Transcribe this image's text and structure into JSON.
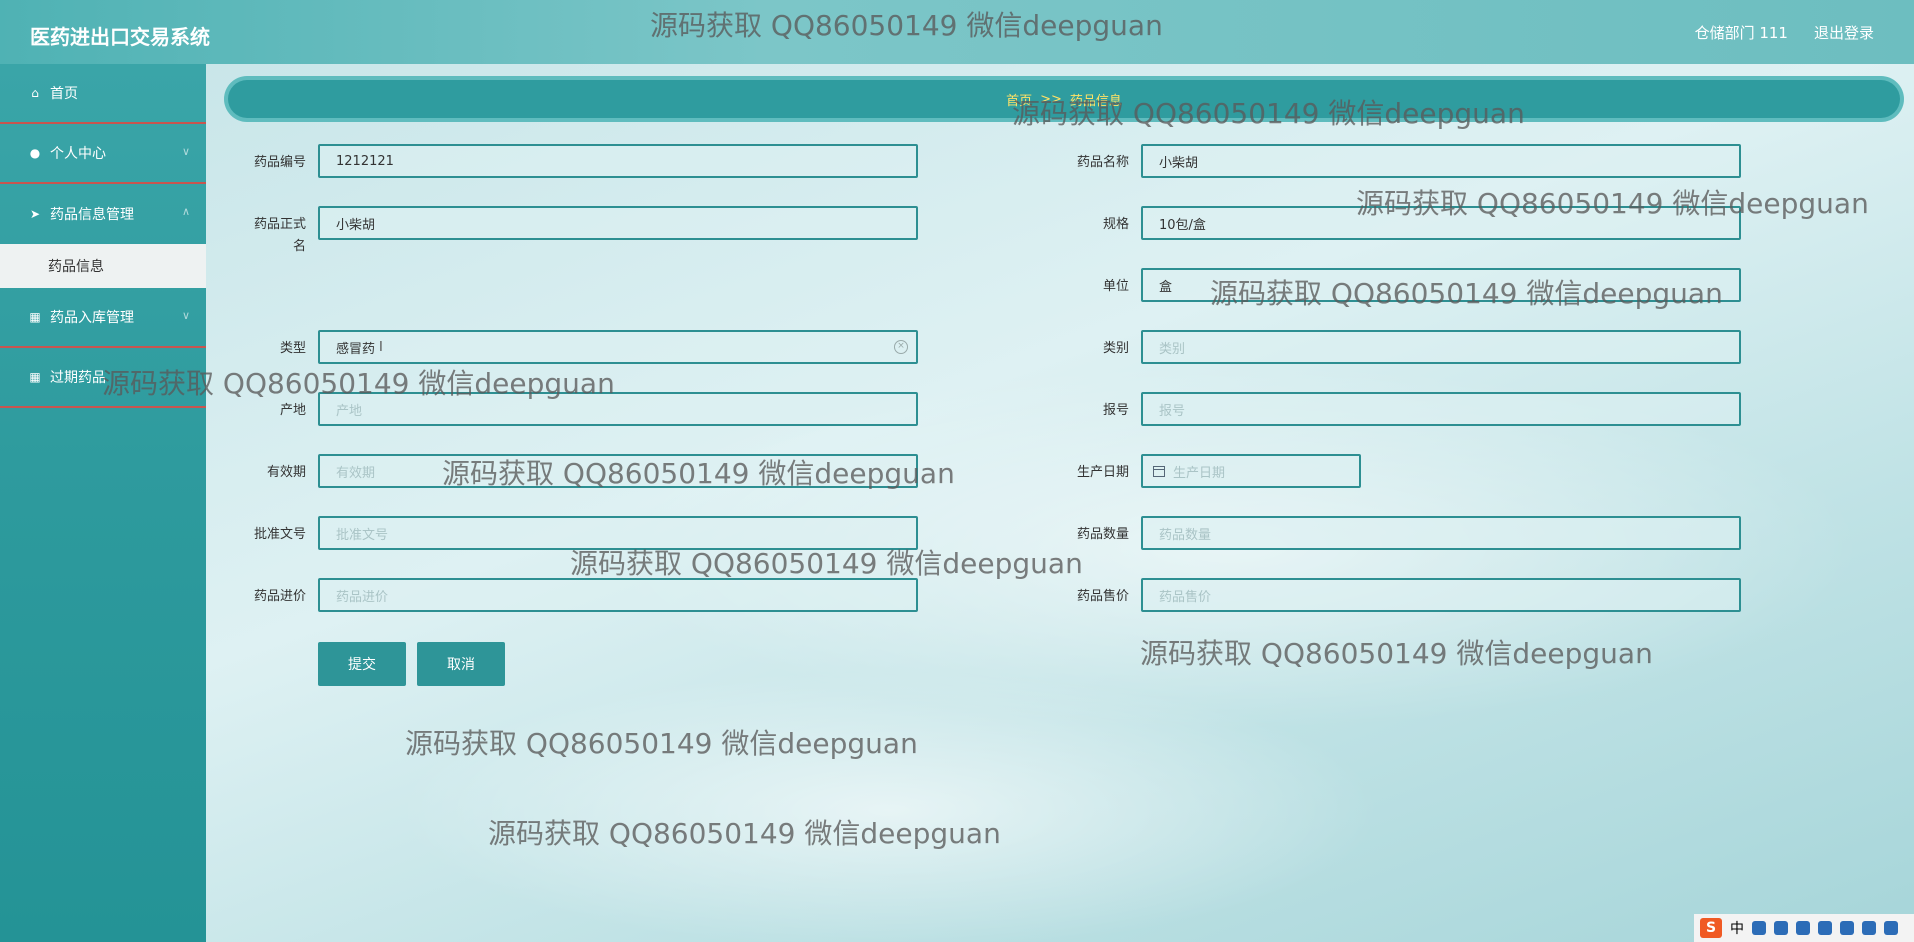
{
  "app": {
    "title": "医药进出口交易系统",
    "user": "仓储部门 111",
    "logout": "退出登录"
  },
  "sidebar": {
    "items": [
      {
        "label": "首页",
        "icon": "home-icon"
      },
      {
        "label": "个人中心",
        "icon": "user-icon"
      },
      {
        "label": "药品信息管理",
        "icon": "send-icon"
      },
      {
        "label": "药品入库管理",
        "icon": "grid-icon"
      },
      {
        "label": "过期药品",
        "icon": "grid-icon"
      }
    ],
    "sub_item": "药品信息"
  },
  "breadcrumb": {
    "home": "首页",
    "separator": ">>",
    "current": "药品信息"
  },
  "form": {
    "drug_code": {
      "label": "药品编号",
      "value": "1212121"
    },
    "drug_name": {
      "label": "药品名称",
      "value": "小柴胡"
    },
    "formal_name": {
      "label_line1": "药品正式",
      "label_line2": "名",
      "value": "小柴胡"
    },
    "spec": {
      "label": "规格",
      "value": "10包/盒"
    },
    "unit": {
      "label": "单位",
      "value": "盒"
    },
    "type": {
      "label": "类型",
      "value": "感冒药"
    },
    "category": {
      "label": "类别",
      "placeholder": "类别"
    },
    "origin": {
      "label": "产地",
      "placeholder": "产地"
    },
    "report_no": {
      "label": "报号",
      "placeholder": "报号"
    },
    "validity": {
      "label": "有效期",
      "placeholder": "有效期"
    },
    "prod_date": {
      "label": "生产日期",
      "placeholder": "生产日期"
    },
    "approval_no": {
      "label": "批准文号",
      "placeholder": "批准文号"
    },
    "quantity": {
      "label": "药品数量",
      "placeholder": "药品数量"
    },
    "purchase_price": {
      "label": "药品进价",
      "placeholder": "药品进价"
    },
    "sale_price": {
      "label": "药品售价",
      "placeholder": "药品售价"
    },
    "submit": "提交",
    "cancel": "取消"
  },
  "watermark": "源码获取 QQ86050149 微信deepguan",
  "ime": {
    "logo": "S",
    "lang": "中"
  }
}
